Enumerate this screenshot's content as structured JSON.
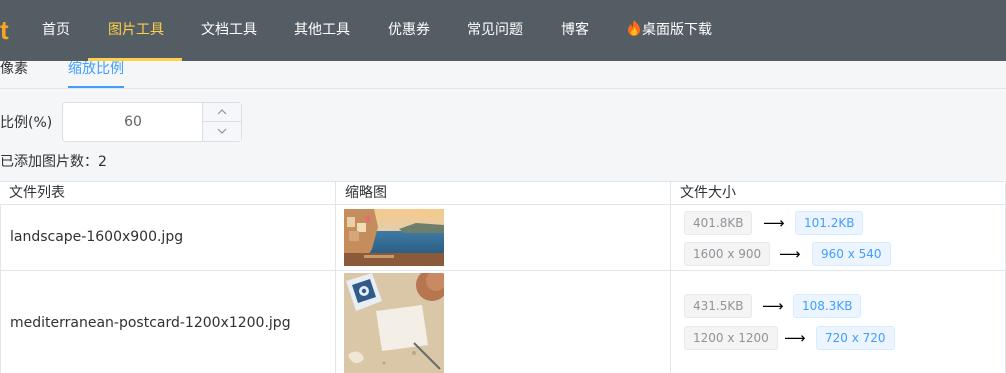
{
  "brand": {
    "logo_text": "t",
    "logo_color": "#f5a623"
  },
  "nav": {
    "items": [
      {
        "label": "首页"
      },
      {
        "label": "图片工具"
      },
      {
        "label": "文档工具"
      },
      {
        "label": "其他工具"
      },
      {
        "label": "优惠券"
      },
      {
        "label": "常见问题"
      },
      {
        "label": "博客"
      },
      {
        "label": "桌面版下载"
      }
    ],
    "active_index": 1,
    "download_icon": "fire-icon",
    "bg_color": "#545c64",
    "active_color": "#ffd04b"
  },
  "subtabs": {
    "items": [
      {
        "label": "像素"
      },
      {
        "label": "缩放比例"
      }
    ],
    "active_index": 1
  },
  "ratio": {
    "label": "比例(%)",
    "value": "60"
  },
  "count": {
    "text": "已添加图片数：2"
  },
  "table": {
    "headers": [
      "文件列表",
      "缩略图",
      "文件大小"
    ],
    "rows": [
      {
        "filename": "landscape-1600x900.jpg",
        "thumbnail": "coastal-village-thumbnail",
        "size_before": "401.8KB",
        "size_after": "101.2KB",
        "dim_before": "1600 x 900",
        "dim_after": "960 x 540"
      },
      {
        "filename": "mediterranean-postcard-1200x1200.jpg",
        "thumbnail": "postcard-tile-thumbnail",
        "size_before": "431.5KB",
        "size_after": "108.3KB",
        "dim_before": "1200 x 1200",
        "dim_after": "720 x 720"
      }
    ],
    "arrow_glyph": "⟶"
  }
}
